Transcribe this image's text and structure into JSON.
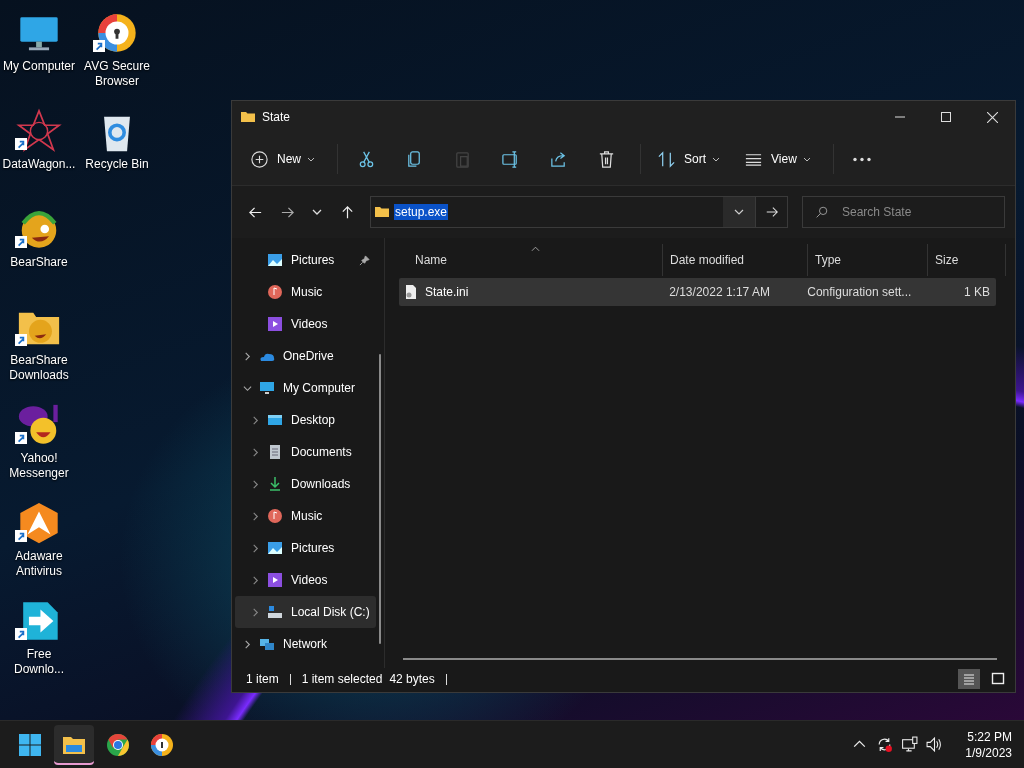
{
  "desktop_icons": [
    {
      "label": "My Computer",
      "kind": "computer",
      "shortcut": false
    },
    {
      "label": "DataWagon...",
      "kind": "datawagon",
      "shortcut": true
    },
    {
      "label": "BearShare",
      "kind": "bearshare",
      "shortcut": true
    },
    {
      "label": "BearShare Downloads",
      "kind": "bearfolder",
      "shortcut": true
    },
    {
      "label": "Yahoo! Messenger",
      "kind": "yahoo",
      "shortcut": true
    },
    {
      "label": "Adaware Antivirus",
      "kind": "adaware",
      "shortcut": true
    },
    {
      "label": "Free Downlo...",
      "kind": "freedl",
      "shortcut": true
    },
    {
      "label": "AVG Secure Browser",
      "kind": "avg",
      "shortcut": true
    },
    {
      "label": "Recycle Bin",
      "kind": "recycle",
      "shortcut": false
    }
  ],
  "window": {
    "title": "State"
  },
  "toolbar": {
    "items": [
      {
        "kind": "new",
        "label": "New",
        "disabled": false
      },
      {
        "kind": "cut",
        "disabled": false
      },
      {
        "kind": "copy",
        "disabled": false
      },
      {
        "kind": "paste",
        "disabled": true
      },
      {
        "kind": "rename",
        "disabled": false
      },
      {
        "kind": "share",
        "disabled": false
      },
      {
        "kind": "delete",
        "disabled": false
      },
      {
        "kind": "sort",
        "label": "Sort",
        "disabled": false
      },
      {
        "kind": "view",
        "label": "View",
        "disabled": false
      },
      {
        "kind": "more",
        "disabled": false
      }
    ]
  },
  "address_bar": {
    "path": "setup.exe",
    "text_selected": true
  },
  "search": {
    "placeholder": "Search State"
  },
  "sidebar": {
    "quick_access": [
      {
        "label": "Pictures",
        "kind": "pictures",
        "pinned": true
      },
      {
        "label": "Music",
        "kind": "music",
        "pinned": false
      },
      {
        "label": "Videos",
        "kind": "videos",
        "pinned": false
      }
    ],
    "items": [
      {
        "label": "OneDrive",
        "kind": "onedrive",
        "expanded": false,
        "selected": false
      },
      {
        "label": "My Computer",
        "kind": "computer",
        "expanded": true,
        "selected": false,
        "children": [
          {
            "label": "Desktop",
            "kind": "desktop",
            "expanded": false,
            "selected": false
          },
          {
            "label": "Documents",
            "kind": "documents",
            "expanded": false,
            "selected": false
          },
          {
            "label": "Downloads",
            "kind": "downloads",
            "expanded": false,
            "selected": false
          },
          {
            "label": "Music",
            "kind": "music",
            "expanded": false,
            "selected": false
          },
          {
            "label": "Pictures",
            "kind": "pictures",
            "expanded": false,
            "selected": false
          },
          {
            "label": "Videos",
            "kind": "videos",
            "expanded": false,
            "selected": false
          },
          {
            "label": "Local Disk (C:)",
            "kind": "disk",
            "expanded": false,
            "selected": true
          }
        ]
      },
      {
        "label": "Network",
        "kind": "network",
        "expanded": false,
        "selected": false
      }
    ]
  },
  "table": {
    "columns": [
      {
        "label": "Name",
        "sorted": true
      },
      {
        "label": "Date modified",
        "sorted": false
      },
      {
        "label": "Type",
        "sorted": false
      },
      {
        "label": "Size",
        "sorted": false
      }
    ],
    "rows": [
      {
        "name": "State.ini",
        "date_modified": "2/13/2022 1:17 AM",
        "type": "Configuration sett...",
        "size": "1 KB",
        "selected": true
      }
    ]
  },
  "status_bar": {
    "item_count": "1 item",
    "selection": "1 item selected",
    "size": "42 bytes",
    "views": [
      {
        "kind": "details",
        "selected": true
      },
      {
        "kind": "large_icons",
        "selected": false
      }
    ]
  },
  "taskbar": {
    "apps": [
      {
        "kind": "start",
        "selected": false
      },
      {
        "kind": "explorer",
        "selected": true
      },
      {
        "kind": "chrome",
        "selected": false
      },
      {
        "kind": "avg",
        "selected": false
      }
    ],
    "tray": {
      "time": "5:22 PM",
      "date": "1/9/2023"
    }
  }
}
